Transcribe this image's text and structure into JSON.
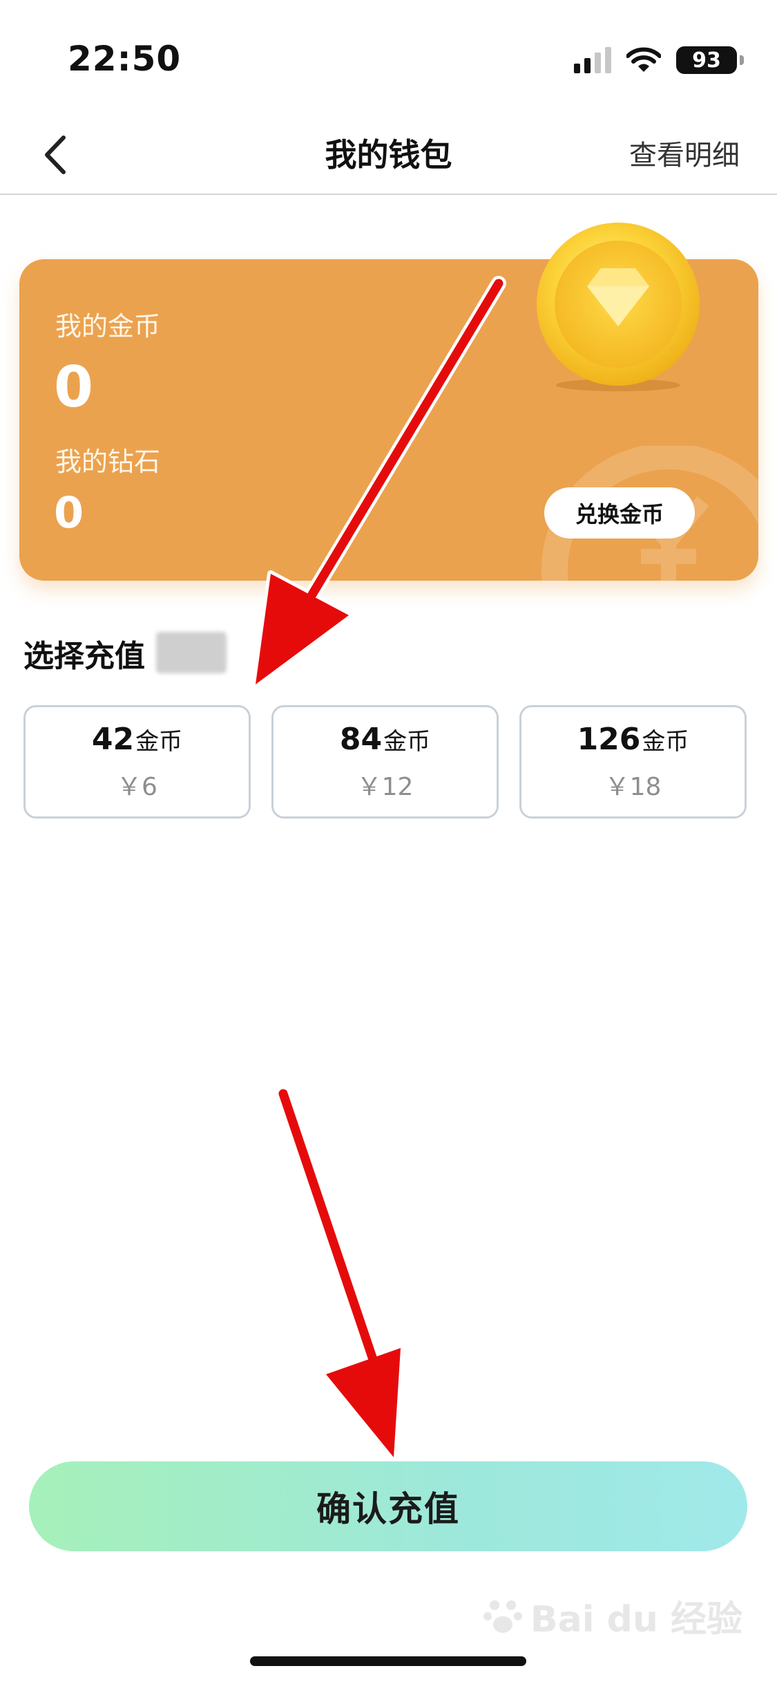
{
  "status_bar": {
    "time": "22:50",
    "battery": "93"
  },
  "nav": {
    "title": "我的钱包",
    "right_label": "查看明细"
  },
  "wallet": {
    "coins_label": "我的金币",
    "coins_value": "0",
    "diamonds_label": "我的钻石",
    "diamonds_value": "0",
    "exchange_label": "兑换金币"
  },
  "recharge": {
    "title": "选择充值",
    "packages": [
      {
        "amount": "42",
        "unit": "金币",
        "price": "￥6"
      },
      {
        "amount": "84",
        "unit": "金币",
        "price": "￥12"
      },
      {
        "amount": "126",
        "unit": "金币",
        "price": "￥18"
      }
    ],
    "confirm_label": "确认充值"
  },
  "watermark": {
    "text": "Bai du 经验"
  },
  "colors": {
    "card_bg": "#eba24e",
    "confirm_gradient": [
      "#a6f0ba",
      "#a0e9ea"
    ],
    "arrow": "#e60b0b"
  }
}
